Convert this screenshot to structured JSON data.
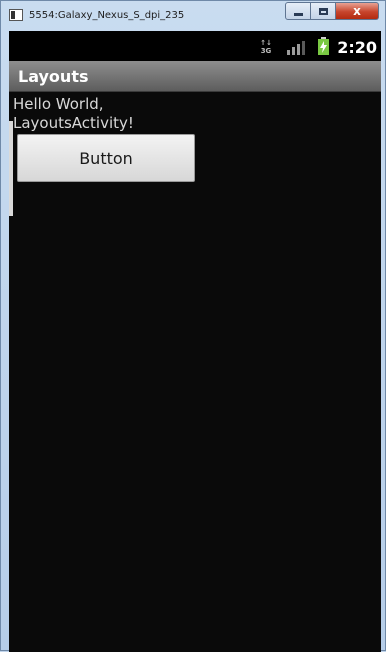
{
  "window": {
    "title": "5554:Galaxy_Nexus_S_dpi_235",
    "close_glyph": "x"
  },
  "statusbar": {
    "network_label": "3G",
    "time": "2:20"
  },
  "appbar": {
    "title": "Layouts"
  },
  "content": {
    "hello_text": "Hello World, LayoutsActivity!",
    "button_label": "Button"
  }
}
